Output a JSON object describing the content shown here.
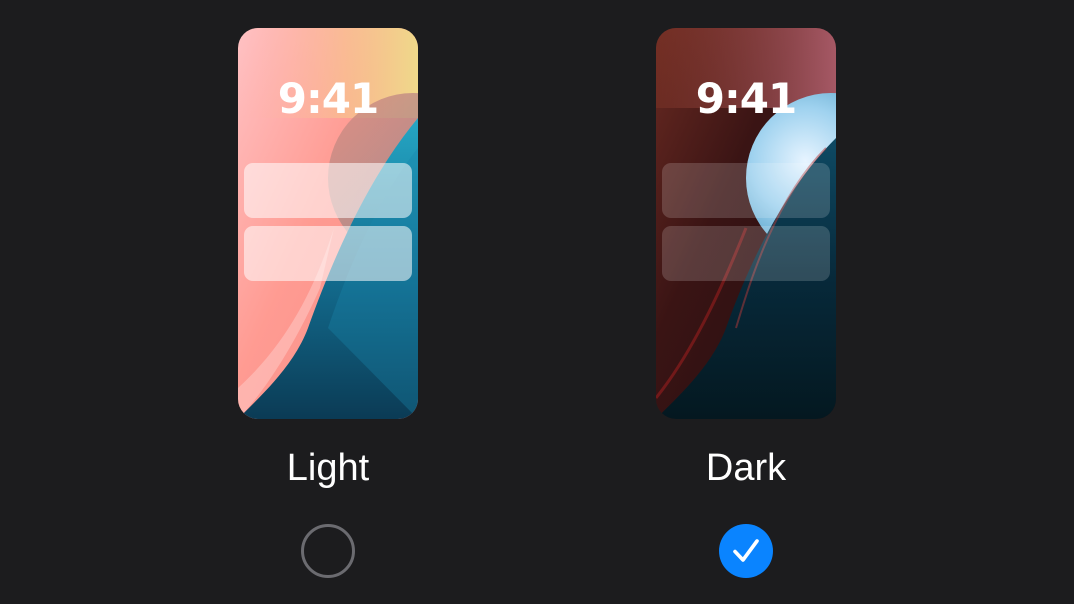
{
  "appearance": {
    "options": [
      {
        "label": "Light",
        "clock": "9:41",
        "selected": false
      },
      {
        "label": "Dark",
        "clock": "9:41",
        "selected": true
      }
    ]
  },
  "colors": {
    "background": "#1c1c1e",
    "accent": "#0a84ff",
    "radio_border": "#6b6b70",
    "text": "#ffffff"
  },
  "icons": {
    "selected_indicator": "checkmark-icon"
  }
}
